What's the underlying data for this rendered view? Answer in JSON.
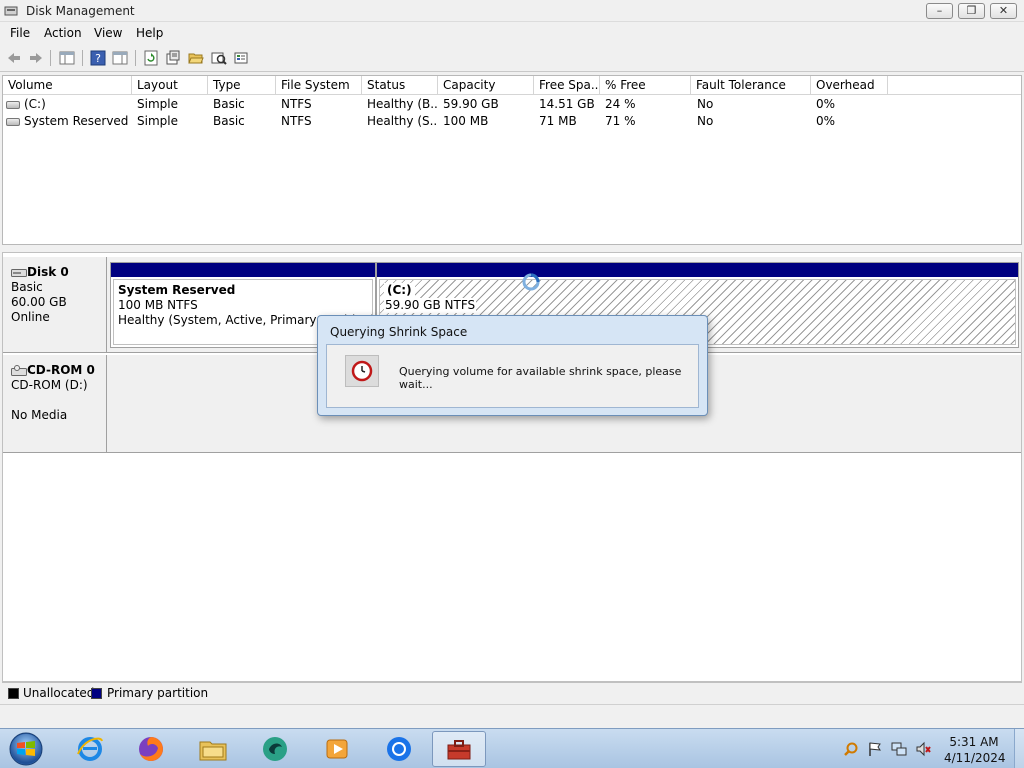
{
  "window": {
    "title": "Disk Management",
    "controls": {
      "minimize": "–",
      "maximize": "❐",
      "close": "✕"
    }
  },
  "menu": [
    "File",
    "Action",
    "View",
    "Help"
  ],
  "toolbar": {
    "icons": [
      "back-arrow-icon",
      "forward-arrow-icon",
      "show-hide-console-tree-icon",
      "help-icon",
      "show-hide-action-pane-icon",
      "refresh-icon",
      "properties-icon",
      "open-folder-icon",
      "explore-icon",
      "settings-icon"
    ]
  },
  "volume_list": {
    "columns": [
      "Volume",
      "Layout",
      "Type",
      "File System",
      "Status",
      "Capacity",
      "Free Spa...",
      "% Free",
      "Fault Tolerance",
      "Overhead"
    ],
    "rows": [
      [
        "(C:)",
        "Simple",
        "Basic",
        "NTFS",
        "Healthy (B...",
        "59.90 GB",
        "14.51 GB",
        "24 %",
        "No",
        "0%"
      ],
      [
        "System Reserved",
        "Simple",
        "Basic",
        "NTFS",
        "Healthy (S...",
        "100 MB",
        "71 MB",
        "71 %",
        "No",
        "0%"
      ]
    ]
  },
  "disks": [
    {
      "name": "Disk 0",
      "type": "Basic",
      "size": "60.00 GB",
      "state": "Online",
      "partitions": [
        {
          "title": "System Reserved",
          "size": "100 MB NTFS",
          "status": "Healthy (System, Active, Primary Partition)"
        },
        {
          "title": "(C:)",
          "size": "59.90 GB NTFS",
          "status": ""
        }
      ]
    },
    {
      "name": "CD-ROM 0",
      "type": "CD-ROM (D:)",
      "media": "No Media"
    }
  ],
  "legend": [
    {
      "label": "Unallocated",
      "color": "#000000"
    },
    {
      "label": "Primary partition",
      "color": "#000080"
    }
  ],
  "dialog": {
    "title": "Querying Shrink Space",
    "message": "Querying volume for available shrink space, please wait..."
  },
  "taskbar": {
    "apps": [
      "internet-explorer-icon",
      "firefox-icon",
      "file-explorer-icon",
      "media-app-icon",
      "media-player-icon",
      "chrome-icon",
      "computer-management-icon"
    ],
    "tray": [
      "search-icon",
      "flag-icon",
      "network-icon",
      "volume-muted-icon"
    ],
    "time": "5:31 AM",
    "date": "4/11/2024"
  }
}
